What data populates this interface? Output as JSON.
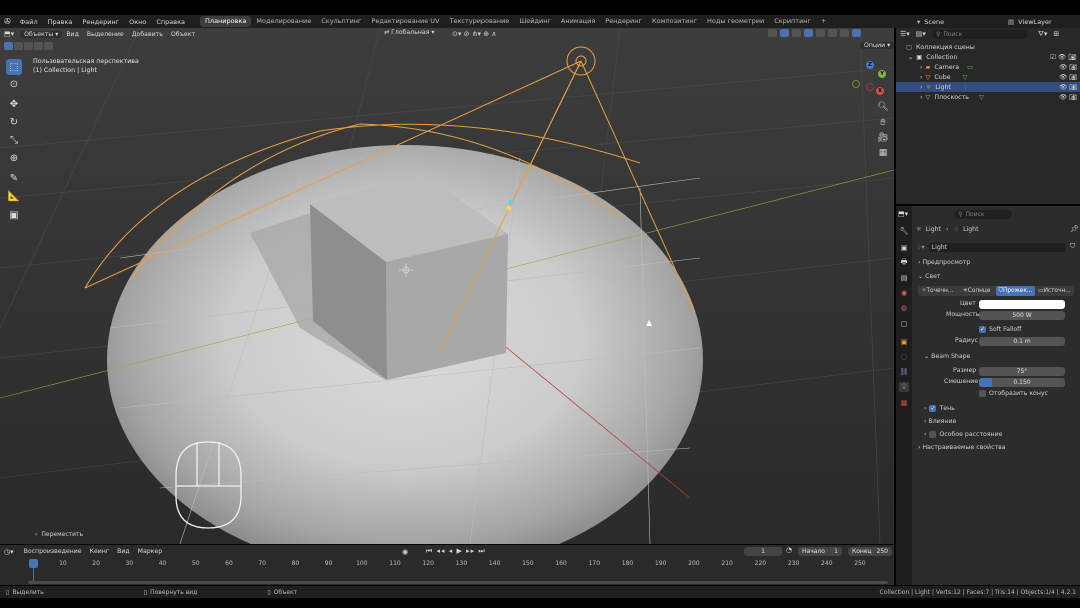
{
  "menu": {
    "items": [
      "Файл",
      "Правка",
      "Рендеринг",
      "Окно",
      "Справка"
    ],
    "workspaces": [
      "Планировка",
      "Моделирование",
      "Скульптинг",
      "Редактирование UV",
      "Текстурирование",
      "Шейдинг",
      "Анимация",
      "Рендеринг",
      "Композитинг",
      "Ноды геометрии",
      "Скриптинг"
    ],
    "active_workspace": "Планировка",
    "add_tab": "+",
    "scene_label": "Scene",
    "viewlayer_label": "ViewLayer"
  },
  "viewport": {
    "mode": "Объекты",
    "menu": [
      "Вид",
      "Выделение",
      "Добавить",
      "Объект"
    ],
    "transform_orientation": "Глобальная",
    "options": "Опции",
    "view_name": "Пользовательская перспектива",
    "collection_info": "(1) Collection | Light",
    "last_operator": "Переместить"
  },
  "gizmo": {
    "z": "Z",
    "y": "Y",
    "x": "X"
  },
  "outliner": {
    "search_placeholder": "Поиск",
    "scene_collection": "Коллекция сцены",
    "collection": "Collection",
    "objects": [
      {
        "name": "Camera",
        "selected": false
      },
      {
        "name": "Cube",
        "selected": false
      },
      {
        "name": "Light",
        "selected": true
      },
      {
        "name": "Плоскость",
        "selected": false
      }
    ]
  },
  "properties": {
    "search_placeholder": "Поиск",
    "breadcrumb_object": "Light",
    "breadcrumb_data": "Light",
    "data_name": "Light",
    "panel_preview": "Предпросмотр",
    "panel_light": "Свет",
    "light_types": [
      "Точечн...",
      "Солнце",
      "Прожек...",
      "Источн..."
    ],
    "active_light_type": "Прожек...",
    "color_label": "Цвет",
    "color_value": "#ffffff",
    "power_label": "Мощность",
    "power_value": "500 W",
    "soft_falloff": "Soft Falloff",
    "radius_label": "Радиус",
    "radius_value": "0.1 m",
    "beam_shape": "Beam Shape",
    "size_label": "Размер",
    "size_value": "75°",
    "blend_label": "Смешение",
    "blend_value": "0.150",
    "blend_fraction": 0.15,
    "show_cone": "Отобразить конус",
    "shadow": "Тень",
    "influence": "Влияние",
    "custom_distance": "Особое расстояние",
    "custom_props": "Настраиваемые свойства"
  },
  "timeline": {
    "menu": [
      "Воспроизведение",
      "Кеинг",
      "Вид",
      "Маркер"
    ],
    "current_frame": "1",
    "start_label": "Начало",
    "start_value": "1",
    "end_label": "Конец",
    "end_value": "250",
    "ticks": [
      "1",
      "10",
      "20",
      "30",
      "40",
      "50",
      "60",
      "70",
      "80",
      "90",
      "100",
      "110",
      "120",
      "130",
      "140",
      "150",
      "160",
      "170",
      "180",
      "190",
      "200",
      "210",
      "220",
      "230",
      "240",
      "250"
    ]
  },
  "status": {
    "select": "Выделить",
    "rotate_view": "Повернуть вид",
    "object": "Объект",
    "stats": "Collection | Light | Verts:12 | Faces:7 | Tris:14 | Objects:1/4 | 4.2.1"
  },
  "colors": {
    "accent": "#4772b3",
    "light_wire": "#e8a042",
    "x_axis": "#b8413c",
    "y_axis": "#8fae3a",
    "selected_row": "#334d80"
  }
}
